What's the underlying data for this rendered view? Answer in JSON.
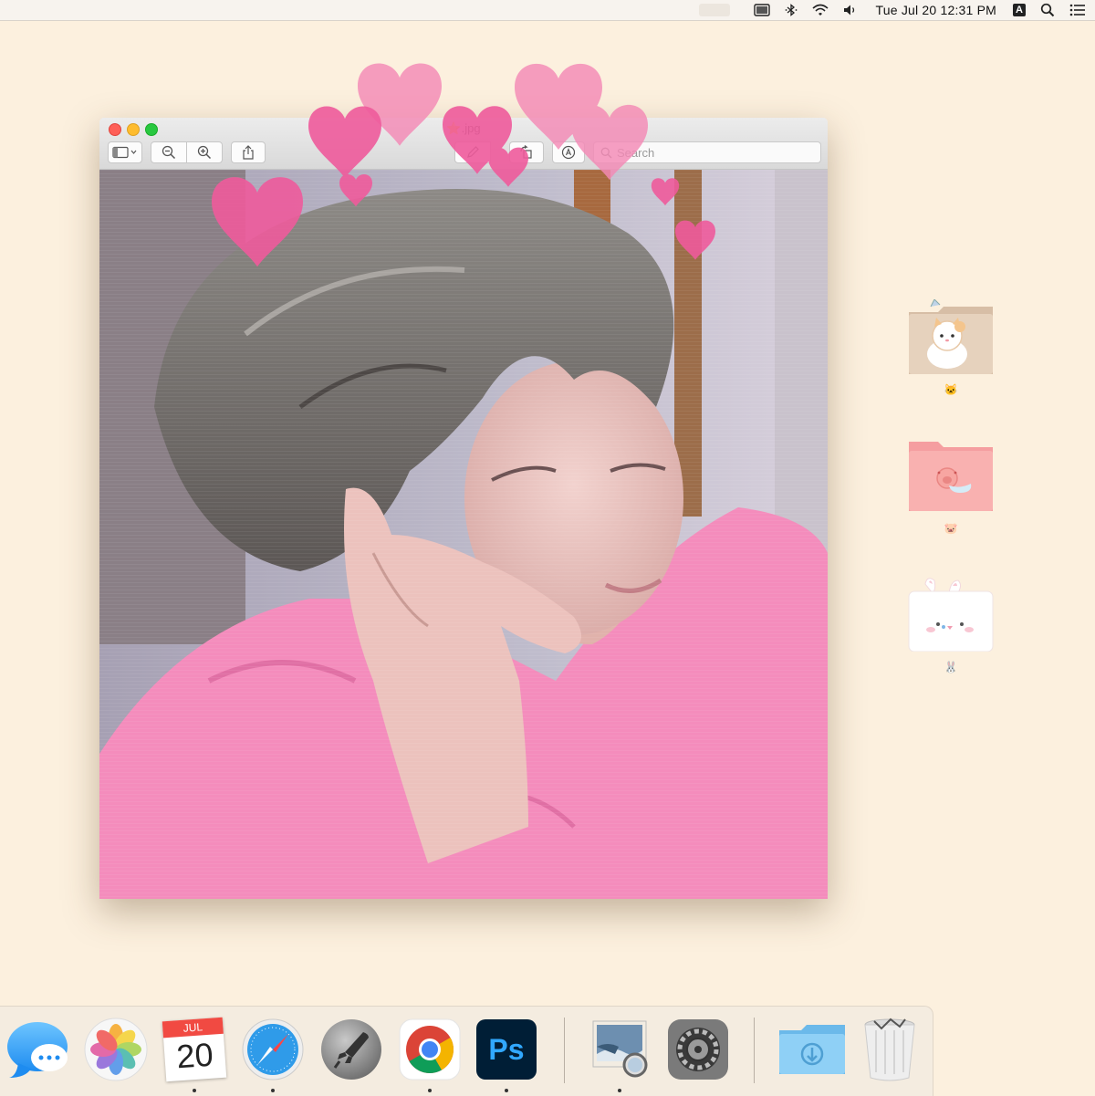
{
  "menubar": {
    "clock": "Tue Jul 20  12:31 PM",
    "input_source": "A",
    "icons": [
      "display-icon",
      "bluetooth-icon",
      "wifi-icon",
      "volume-icon",
      "input-source-icon",
      "spotlight-search-icon",
      "control-center-icon"
    ]
  },
  "window": {
    "title": "⭐.jpg",
    "search_placeholder": "Search",
    "toolbar_icons": [
      "sidebar-toggle-icon",
      "zoom-out-icon",
      "zoom-in-icon",
      "share-icon",
      "markup-pen-icon",
      "rotate-icon",
      "annotate-icon",
      "search-icon"
    ],
    "photo_description_icon": "photo-pink-shirt-person"
  },
  "desktop": {
    "folders": [
      {
        "label": "🐱",
        "icon": "cat-folder-icon"
      },
      {
        "label": "🐷",
        "icon": "pig-folder-icon"
      },
      {
        "label": "🐰",
        "icon": "bunny-folder-icon"
      }
    ]
  },
  "dock": {
    "apps": [
      {
        "name": "Messages",
        "icon": "messages-icon",
        "running": false
      },
      {
        "name": "Photos",
        "icon": "photos-icon",
        "running": false
      },
      {
        "name": "Calendar",
        "icon": "calendar-icon",
        "running": true,
        "month": "JUL",
        "day": "20"
      },
      {
        "name": "Safari",
        "icon": "safari-icon",
        "running": true
      },
      {
        "name": "Launchpad",
        "icon": "launchpad-icon",
        "running": false
      },
      {
        "name": "Chrome",
        "icon": "chrome-icon",
        "running": true
      },
      {
        "name": "Photoshop",
        "icon": "photoshop-icon",
        "running": true,
        "glyph": "Ps"
      },
      {
        "name": "Preview",
        "icon": "preview-icon",
        "running": true
      },
      {
        "name": "System Preferences",
        "icon": "system-preferences-icon",
        "running": false
      },
      {
        "name": "Downloads",
        "icon": "downloads-folder-icon",
        "running": false
      },
      {
        "name": "Trash",
        "icon": "trash-icon",
        "running": false
      }
    ]
  },
  "colors": {
    "desktop_bg": "#fcf0de",
    "heart_pink": "#f06fa6",
    "shirt_pink": "#f48cbc",
    "photoshop_blue": "#31a8ff"
  }
}
